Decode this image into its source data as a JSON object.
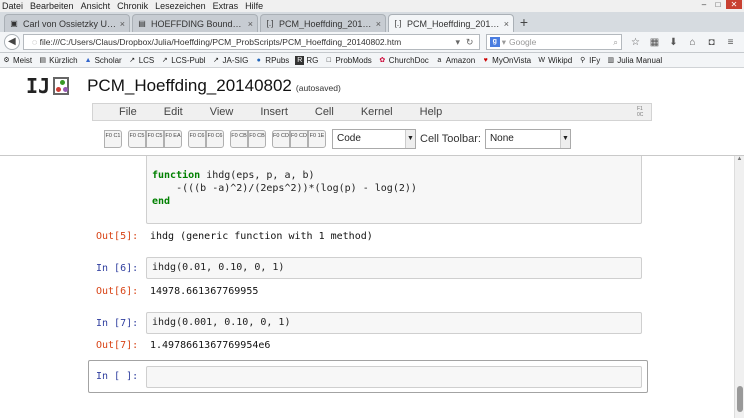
{
  "os_menu": [
    "Datei",
    "Bearbeiten",
    "Ansicht",
    "Chronik",
    "Lesezeichen",
    "Extras",
    "Hilfe"
  ],
  "window_controls": {
    "minimize": "–",
    "maximize": "□",
    "close": "✕"
  },
  "tabs": [
    {
      "label": "Carl von Ossietzky Universi...",
      "icon": "university-icon"
    },
    {
      "label": "HOEFFDING Bounds - Old...",
      "icon": "page-icon"
    },
    {
      "label": "PCM_Hoeffding_20140802",
      "icon": "jupyter-icon"
    },
    {
      "label": "PCM_Hoeffding_20140802",
      "icon": "jupyter-icon"
    }
  ],
  "new_tab": "+",
  "url": "file:///C:/Users/Claus/Dropbox/Julia/Hoeffding/PCM_ProbScripts/PCM_Hoeffding_20140802.htm",
  "search": {
    "engine": "g",
    "placeholder": "Google"
  },
  "bookmarks": [
    "Meist",
    "Kürzlich",
    "Scholar",
    "LCS",
    "LCS-Publ",
    "JA-SIG",
    "RPubs",
    "RG",
    "ProbMods",
    "ChurchDoc",
    "Amazon",
    "MyOnVista",
    "Wikipd",
    "IFy",
    "Julia Manual"
  ],
  "notebook": {
    "logo": "IJ",
    "title": "PCM_Hoeffding_20140802",
    "autosaved": "(autosaved)",
    "menu": [
      "File",
      "Edit",
      "View",
      "Insert",
      "Cell",
      "Kernel",
      "Help"
    ],
    "cell_type": "Code",
    "cell_toolbar_label": "Cell Toolbar:",
    "cell_toolbar_value": "None"
  },
  "toolbar_buttons": [
    {
      "group": 1,
      "name": "save",
      "label": "F0 C1"
    },
    {
      "group": 2,
      "name": "cut",
      "label": "F0 C5"
    },
    {
      "group": 2,
      "name": "copy",
      "label": "F0 C5"
    },
    {
      "group": 2,
      "name": "paste",
      "label": "F0 EA"
    },
    {
      "group": 3,
      "name": "move-up",
      "label": "F0 C6"
    },
    {
      "group": 3,
      "name": "move-down",
      "label": "F0 C6"
    },
    {
      "group": 4,
      "name": "insert-above",
      "label": "F0 CB"
    },
    {
      "group": 4,
      "name": "insert-below",
      "label": "F0 CB"
    },
    {
      "group": 5,
      "name": "run",
      "label": "F0 CD"
    },
    {
      "group": 5,
      "name": "interrupt",
      "label": "F0 CD"
    },
    {
      "group": 5,
      "name": "restart",
      "label": "F0 1E"
    }
  ],
  "cells": {
    "func": {
      "line1_kw": "function",
      "line1_rest": " ihdg(eps, p, a, b)",
      "line2": "    -(((b -a)^2)/(2eps^2))*(log(p) - log(2))",
      "line3_kw": "end"
    },
    "out5": {
      "prompt": "Out[5]:",
      "text": "ihdg (generic function with 1 method)"
    },
    "in6": {
      "prompt": "In [6]:",
      "code": "ihdg(0.01, 0.10, 0, 1)"
    },
    "out6": {
      "prompt": "Out[6]:",
      "text": "14978.661367769955"
    },
    "in7": {
      "prompt": "In [7]:",
      "code": "ihdg(0.001, 0.10, 0, 1)"
    },
    "out7": {
      "prompt": "Out[7]:",
      "text": "1.4978661367769954e6"
    },
    "in_empty": {
      "prompt": "In [ ]:",
      "code": ""
    }
  }
}
